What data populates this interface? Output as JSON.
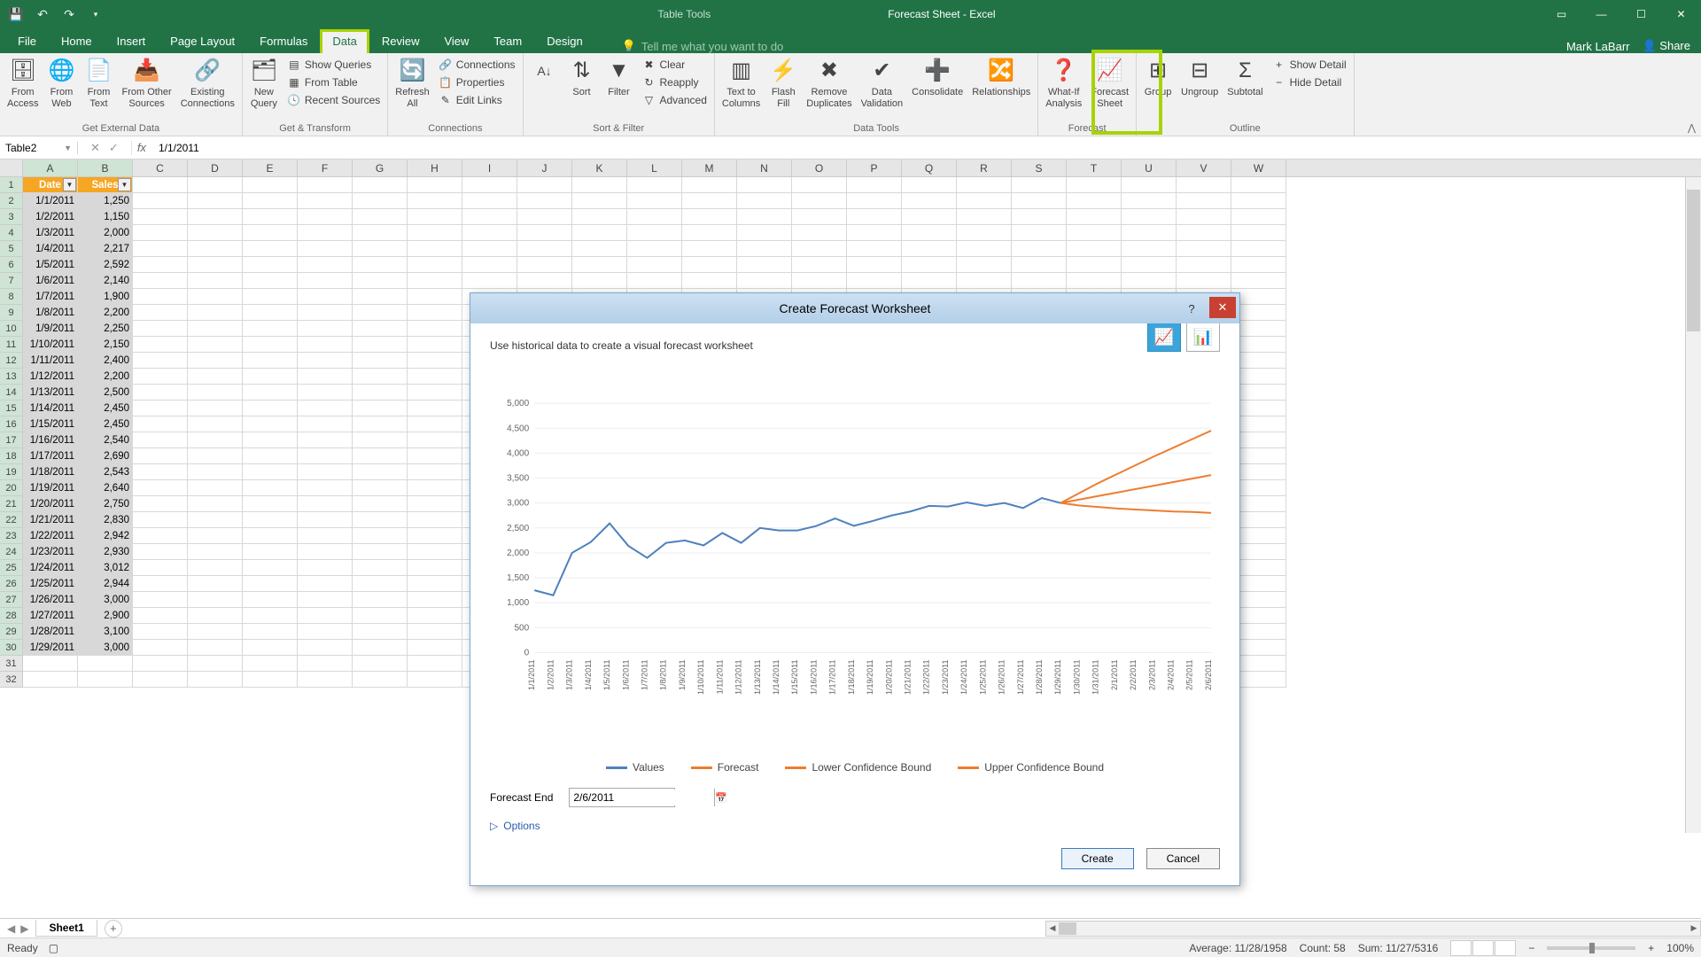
{
  "app": {
    "title": "Forecast Sheet - Excel",
    "context_tab": "Table Tools",
    "user": "Mark LaBarr",
    "share": "Share"
  },
  "tabs": [
    "File",
    "Home",
    "Insert",
    "Page Layout",
    "Formulas",
    "Data",
    "Review",
    "View",
    "Team",
    "Design"
  ],
  "active_tab": "Data",
  "tellme_placeholder": "Tell me what you want to do",
  "ribbon": {
    "external": {
      "from_access": "From\nAccess",
      "from_web": "From\nWeb",
      "from_text": "From\nText",
      "from_other": "From Other\nSources",
      "existing": "Existing\nConnections",
      "group_label": "Get External Data"
    },
    "transform": {
      "new_query": "New\nQuery",
      "show_queries": "Show Queries",
      "from_table": "From Table",
      "recent_sources": "Recent Sources",
      "group_label": "Get & Transform"
    },
    "connections": {
      "refresh_all": "Refresh\nAll",
      "connections": "Connections",
      "properties": "Properties",
      "edit_links": "Edit Links",
      "group_label": "Connections"
    },
    "sortfilter": {
      "sort": "Sort",
      "filter": "Filter",
      "clear": "Clear",
      "reapply": "Reapply",
      "advanced": "Advanced",
      "group_label": "Sort & Filter"
    },
    "datatools": {
      "text_to_columns": "Text to\nColumns",
      "flash_fill": "Flash\nFill",
      "remove_dup": "Remove\nDuplicates",
      "data_validation": "Data\nValidation",
      "consolidate": "Consolidate",
      "relationships": "Relationships",
      "group_label": "Data Tools"
    },
    "forecast": {
      "whatif": "What-If\nAnalysis",
      "forecast_sheet": "Forecast\nSheet",
      "group_label": "Forecast"
    },
    "outline": {
      "group": "Group",
      "ungroup": "Ungroup",
      "subtotal": "Subtotal",
      "show_detail": "Show Detail",
      "hide_detail": "Hide Detail",
      "group_label": "Outline"
    }
  },
  "namebox": "Table2",
  "formula": "1/1/2011",
  "columns": [
    "A",
    "B",
    "C",
    "D",
    "E",
    "F",
    "G",
    "H",
    "I",
    "J",
    "K",
    "L",
    "M",
    "N",
    "O",
    "P",
    "Q",
    "R",
    "S",
    "T",
    "U",
    "V",
    "W"
  ],
  "table": {
    "headers": [
      "Date",
      "Sales"
    ],
    "rows": [
      [
        "1/1/2011",
        "1,250"
      ],
      [
        "1/2/2011",
        "1,150"
      ],
      [
        "1/3/2011",
        "2,000"
      ],
      [
        "1/4/2011",
        "2,217"
      ],
      [
        "1/5/2011",
        "2,592"
      ],
      [
        "1/6/2011",
        "2,140"
      ],
      [
        "1/7/2011",
        "1,900"
      ],
      [
        "1/8/2011",
        "2,200"
      ],
      [
        "1/9/2011",
        "2,250"
      ],
      [
        "1/10/2011",
        "2,150"
      ],
      [
        "1/11/2011",
        "2,400"
      ],
      [
        "1/12/2011",
        "2,200"
      ],
      [
        "1/13/2011",
        "2,500"
      ],
      [
        "1/14/2011",
        "2,450"
      ],
      [
        "1/15/2011",
        "2,450"
      ],
      [
        "1/16/2011",
        "2,540"
      ],
      [
        "1/17/2011",
        "2,690"
      ],
      [
        "1/18/2011",
        "2,543"
      ],
      [
        "1/19/2011",
        "2,640"
      ],
      [
        "1/20/2011",
        "2,750"
      ],
      [
        "1/21/2011",
        "2,830"
      ],
      [
        "1/22/2011",
        "2,942"
      ],
      [
        "1/23/2011",
        "2,930"
      ],
      [
        "1/24/2011",
        "3,012"
      ],
      [
        "1/25/2011",
        "2,944"
      ],
      [
        "1/26/2011",
        "3,000"
      ],
      [
        "1/27/2011",
        "2,900"
      ],
      [
        "1/28/2011",
        "3,100"
      ],
      [
        "1/29/2011",
        "3,000"
      ]
    ]
  },
  "sheets": {
    "active": "Sheet1"
  },
  "status": {
    "ready": "Ready",
    "average_label": "Average:",
    "average": "11/28/1958",
    "count_label": "Count:",
    "count": "58",
    "sum_label": "Sum:",
    "sum": "11/27/5316",
    "zoom": "100%"
  },
  "dialog": {
    "title": "Create Forecast Worksheet",
    "desc": "Use historical data to create a visual forecast worksheet",
    "forecast_end_label": "Forecast End",
    "forecast_end_value": "2/6/2011",
    "options": "Options",
    "create": "Create",
    "cancel": "Cancel",
    "legend": [
      "Values",
      "Forecast",
      "Lower Confidence Bound",
      "Upper Confidence Bound"
    ]
  },
  "chart_data": {
    "type": "line",
    "title": "",
    "xlabel": "",
    "ylabel": "",
    "ylim": [
      0,
      5000
    ],
    "yticks": [
      0,
      500,
      1000,
      1500,
      2000,
      2500,
      3000,
      3500,
      4000,
      4500,
      5000
    ],
    "categories": [
      "1/1/2011",
      "1/2/2011",
      "1/3/2011",
      "1/4/2011",
      "1/5/2011",
      "1/6/2011",
      "1/7/2011",
      "1/8/2011",
      "1/9/2011",
      "1/10/2011",
      "1/11/2011",
      "1/12/2011",
      "1/13/2011",
      "1/14/2011",
      "1/15/2011",
      "1/16/2011",
      "1/17/2011",
      "1/18/2011",
      "1/19/2011",
      "1/20/2011",
      "1/21/2011",
      "1/22/2011",
      "1/23/2011",
      "1/24/2011",
      "1/25/2011",
      "1/26/2011",
      "1/27/2011",
      "1/28/2011",
      "1/29/2011",
      "1/30/2011",
      "1/31/2011",
      "2/1/2011",
      "2/2/2011",
      "2/3/2011",
      "2/4/2011",
      "2/5/2011",
      "2/6/2011"
    ],
    "series": [
      {
        "name": "Values",
        "color": "#4f81bd",
        "values": [
          1250,
          1150,
          2000,
          2217,
          2592,
          2140,
          1900,
          2200,
          2250,
          2150,
          2400,
          2200,
          2500,
          2450,
          2450,
          2540,
          2690,
          2543,
          2640,
          2750,
          2830,
          2942,
          2930,
          3012,
          2944,
          3000,
          2900,
          3100,
          3000,
          null,
          null,
          null,
          null,
          null,
          null,
          null,
          null
        ]
      },
      {
        "name": "Forecast",
        "color": "#ed7d31",
        "values": [
          null,
          null,
          null,
          null,
          null,
          null,
          null,
          null,
          null,
          null,
          null,
          null,
          null,
          null,
          null,
          null,
          null,
          null,
          null,
          null,
          null,
          null,
          null,
          null,
          null,
          null,
          null,
          null,
          3000,
          3070,
          3140,
          3210,
          3280,
          3350,
          3420,
          3490,
          3560
        ]
      },
      {
        "name": "Lower Confidence Bound",
        "color": "#ed7d31",
        "values": [
          null,
          null,
          null,
          null,
          null,
          null,
          null,
          null,
          null,
          null,
          null,
          null,
          null,
          null,
          null,
          null,
          null,
          null,
          null,
          null,
          null,
          null,
          null,
          null,
          null,
          null,
          null,
          null,
          3000,
          2950,
          2920,
          2890,
          2870,
          2850,
          2830,
          2820,
          2800
        ]
      },
      {
        "name": "Upper Confidence Bound",
        "color": "#ed7d31",
        "values": [
          null,
          null,
          null,
          null,
          null,
          null,
          null,
          null,
          null,
          null,
          null,
          null,
          null,
          null,
          null,
          null,
          null,
          null,
          null,
          null,
          null,
          null,
          null,
          null,
          null,
          null,
          null,
          null,
          3000,
          3200,
          3400,
          3580,
          3760,
          3940,
          4110,
          4280,
          4450
        ]
      }
    ]
  }
}
